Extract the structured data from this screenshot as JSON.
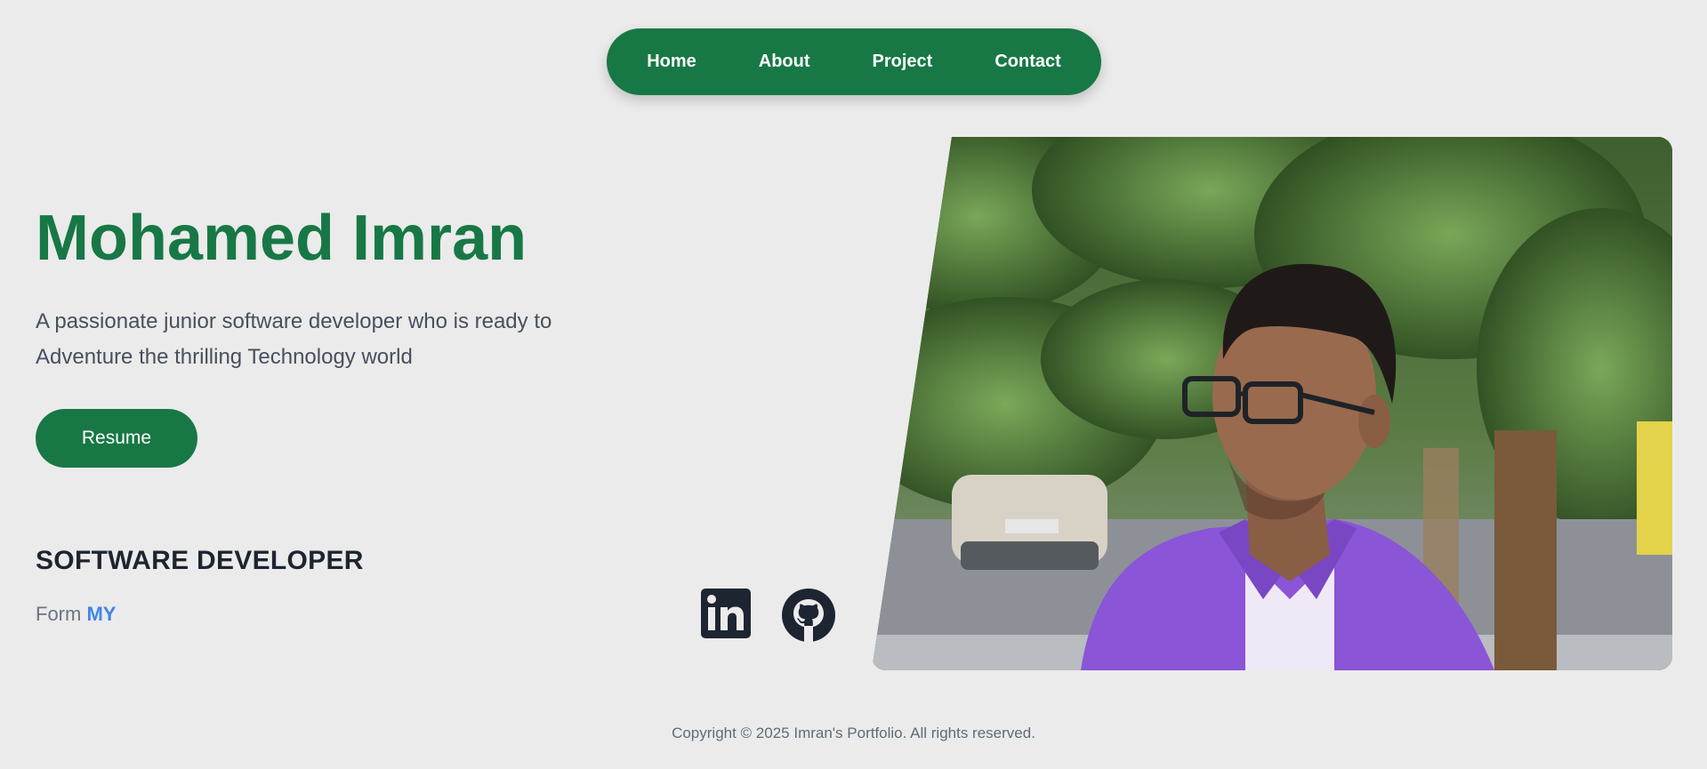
{
  "nav": {
    "items": [
      {
        "label": "Home"
      },
      {
        "label": "About"
      },
      {
        "label": "Project"
      },
      {
        "label": "Contact"
      }
    ]
  },
  "hero": {
    "name": "Mohamed Imran",
    "description": "A passionate junior software developer who is ready to Adventure the thrilling Technology world",
    "resume_label": "Resume",
    "role": "SOFTWARE DEVELOPER",
    "from_label": "Form",
    "from_value": "MY"
  },
  "social": [
    {
      "icon": "linkedin-icon"
    },
    {
      "icon": "github-icon"
    }
  ],
  "photo": {
    "subject": "portrait-photo"
  },
  "footer": {
    "copyright": "Copyright © 2025 Imran's Portfolio. All rights reserved."
  },
  "colors": {
    "accent": "#177845",
    "background": "#ebebeb",
    "heading": "#1e2532",
    "link": "#3f86e8"
  }
}
